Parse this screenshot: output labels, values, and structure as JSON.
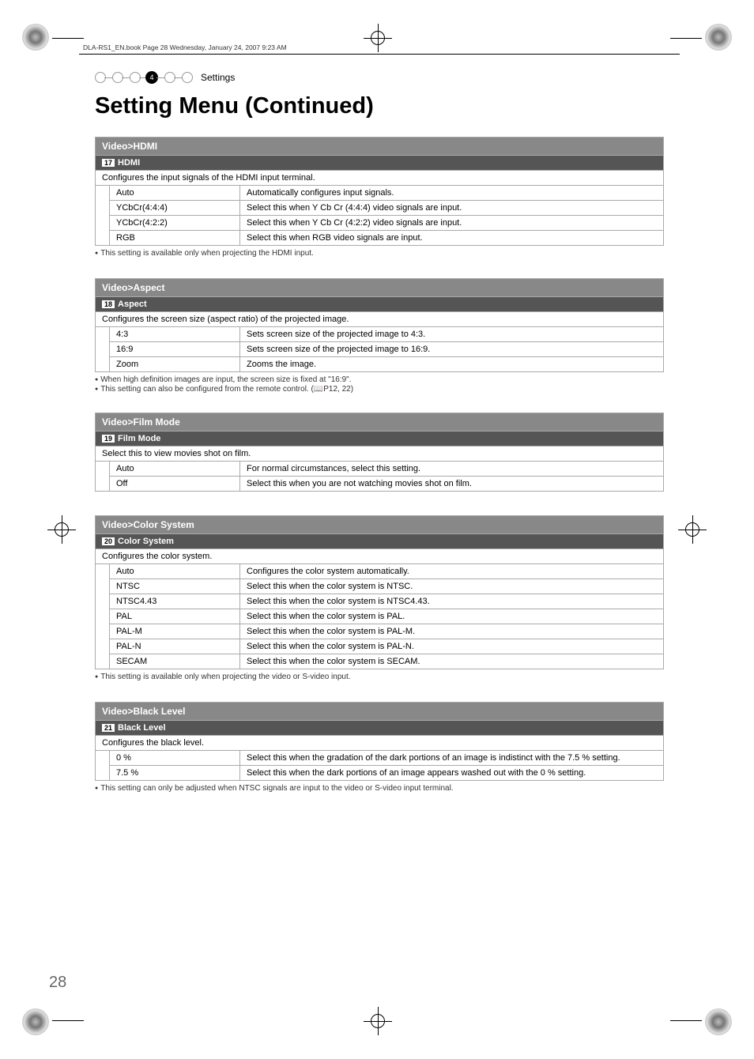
{
  "page_header": "DLA-RS1_EN.book  Page 28  Wednesday, January 24, 2007  9:23 AM",
  "breadcrumb": {
    "active_num": "4",
    "label": "Settings"
  },
  "page_title": "Setting Menu (Continued)",
  "page_num": "28",
  "sections": [
    {
      "path": "Video>HDMI",
      "num": "17",
      "name": "HDMI",
      "desc": "Configures the input signals of the HDMI input terminal.",
      "options": [
        {
          "label": "Auto",
          "text": "Automatically configures input signals."
        },
        {
          "label": "YCbCr(4:4:4)",
          "text": "Select this when Y Cb Cr (4:4:4) video signals are input."
        },
        {
          "label": "YCbCr(4:2:2)",
          "text": "Select this when Y Cb Cr (4:2:2) video signals are input."
        },
        {
          "label": "RGB",
          "text": "Select this when RGB video signals are input."
        }
      ],
      "notes": [
        "This setting is available only when projecting the HDMI input."
      ]
    },
    {
      "path": "Video>Aspect",
      "num": "18",
      "name": "Aspect",
      "desc": "Configures the screen size (aspect ratio) of the projected image.",
      "options": [
        {
          "label": "4:3",
          "text": "Sets screen size of the projected image to 4:3."
        },
        {
          "label": "16:9",
          "text": "Sets screen size of the projected image to 16:9."
        },
        {
          "label": "Zoom",
          "text": "Zooms the image."
        }
      ],
      "notes": [
        "When high definition images are input, the screen size is fixed at \"16:9\".",
        "This setting can also be configured from the remote control. (📖P12, 22)"
      ]
    },
    {
      "path": "Video>Film Mode",
      "num": "19",
      "name": "Film Mode",
      "desc": "Select this to view movies shot on film.",
      "options": [
        {
          "label": "Auto",
          "text": "For normal circumstances, select this setting."
        },
        {
          "label": "Off",
          "text": "Select this when you are not watching movies shot on film."
        }
      ],
      "notes": []
    },
    {
      "path": "Video>Color System",
      "num": "20",
      "name": "Color System",
      "desc": "Configures the color system.",
      "options": [
        {
          "label": "Auto",
          "text": "Configures the color system automatically."
        },
        {
          "label": "NTSC",
          "text": "Select this when the color system is NTSC."
        },
        {
          "label": "NTSC4.43",
          "text": "Select this when the color system is NTSC4.43."
        },
        {
          "label": "PAL",
          "text": "Select this when the color system is PAL."
        },
        {
          "label": "PAL-M",
          "text": "Select this when the color system is PAL-M."
        },
        {
          "label": "PAL-N",
          "text": "Select this when the color system is PAL-N."
        },
        {
          "label": "SECAM",
          "text": "Select this when the color system is SECAM."
        }
      ],
      "notes": [
        "This setting is available only when projecting the video or S-video input."
      ]
    },
    {
      "path": "Video>Black Level",
      "num": "21",
      "name": "Black Level",
      "desc": "Configures the black level.",
      "options": [
        {
          "label": "0 %",
          "text": "Select this when the gradation of the dark portions of an image is indistinct with the 7.5 % setting."
        },
        {
          "label": "7.5 %",
          "text": "Select this when the dark portions of an image appears washed out with the 0 % setting."
        }
      ],
      "notes": [
        "This setting can only be adjusted when NTSC signals are input to the video or S-video input terminal."
      ]
    }
  ]
}
